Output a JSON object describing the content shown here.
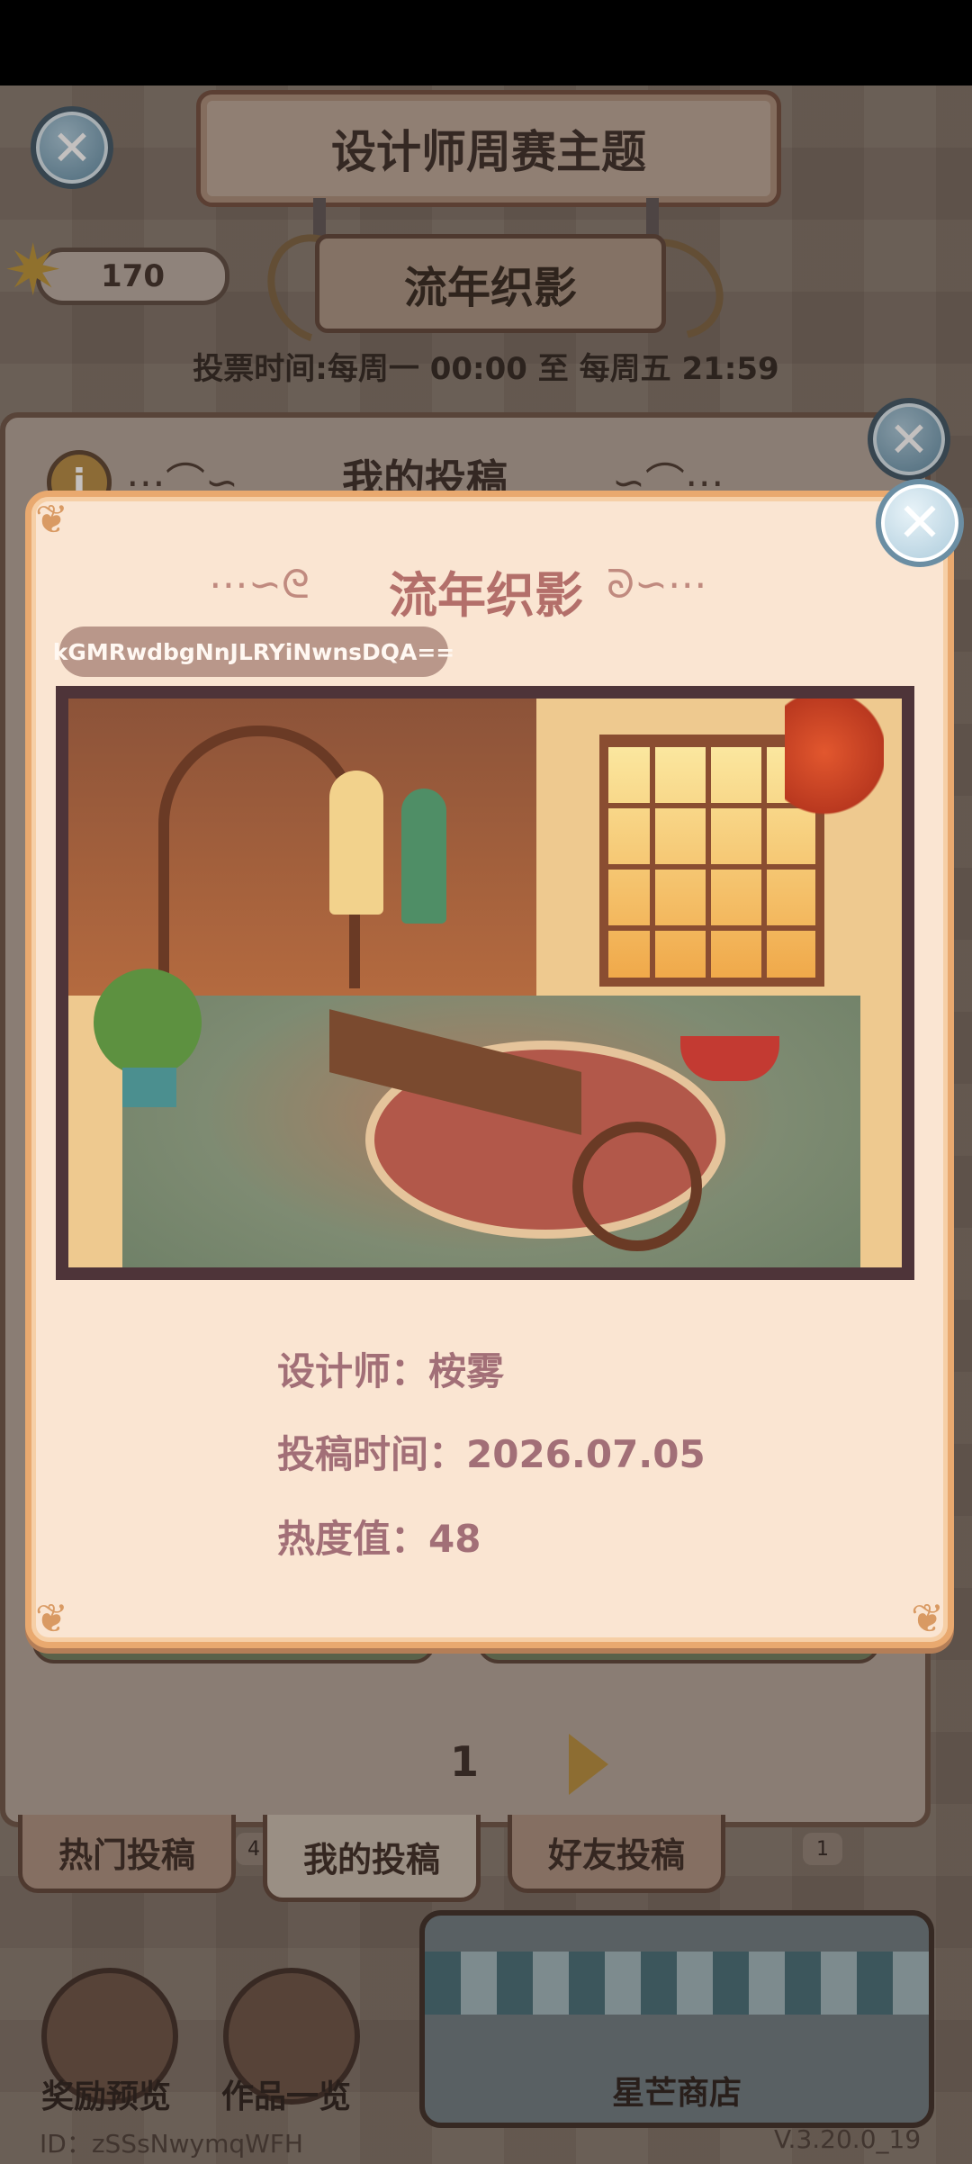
{
  "header": {
    "title": "设计师周赛主题",
    "theme": "流年织影",
    "star_count": "170",
    "vote_time": "投票时间:每周一 00:00 至 每周五 21:59"
  },
  "background_panel": {
    "title": "我的投稿",
    "page_number": "1"
  },
  "tabs": [
    {
      "label": "热门投稿",
      "count": "4"
    },
    {
      "label": "我的投稿",
      "active": true
    },
    {
      "label": "好友投稿",
      "count": "1"
    }
  ],
  "bottom": {
    "reward_preview": "奖励预览",
    "works_overview": "作品一览",
    "shop": "星芒商店",
    "user_id": "ID：zSSsNwymqWFH",
    "version": "V.3.20.0_19"
  },
  "modal": {
    "title": "流年织影",
    "code": "kGMRwdbgNnJLRYiNwnsDQA==",
    "designer": "设计师：桉雾",
    "submit_time": "投稿时间：2026.07.05",
    "heat": "热度值：48"
  },
  "icons": {
    "close": "close-icon",
    "star": "star-icon",
    "info": "info-icon",
    "next": "next-page-icon"
  },
  "colors": {
    "modal_bg": "#fae5d2",
    "modal_border": "#e9a96f",
    "modal_text": "#a26f77",
    "title_text": "#b36f6a"
  }
}
